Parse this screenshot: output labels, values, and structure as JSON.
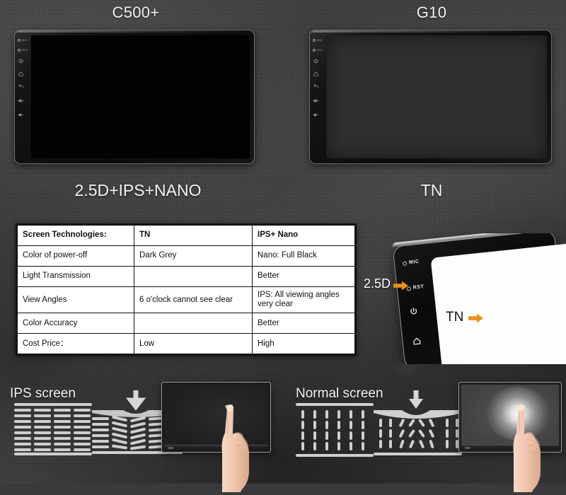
{
  "background": {
    "base_color": "#3a3a3c",
    "style": "dark concrete texture"
  },
  "top_section": {
    "left_device": {
      "title": "C500+",
      "subtitle": "2.5D+IPS+NANO",
      "panel_type": "nano-black",
      "side_buttons": [
        {
          "name": "mic-button",
          "label": "MIC",
          "icon": "mic-icon"
        },
        {
          "name": "reset-button",
          "label": "RST",
          "icon": "reset-icon"
        },
        {
          "name": "power-button",
          "label": "",
          "icon": "power-icon"
        },
        {
          "name": "home-button",
          "label": "",
          "icon": "home-icon"
        },
        {
          "name": "back-button",
          "label": "",
          "icon": "back-icon"
        },
        {
          "name": "volume-up-button",
          "label": "",
          "icon": "volume-up-icon"
        },
        {
          "name": "volume-down-button",
          "label": "",
          "icon": "volume-down-icon"
        }
      ]
    },
    "right_device": {
      "title": "G10",
      "subtitle": "TN",
      "panel_type": "tn-grey",
      "side_buttons": [
        {
          "name": "mic-button",
          "label": "MIC",
          "icon": "mic-icon"
        },
        {
          "name": "reset-button",
          "label": "RST",
          "icon": "reset-icon"
        },
        {
          "name": "power-button",
          "label": "",
          "icon": "power-icon"
        },
        {
          "name": "home-button",
          "label": "",
          "icon": "home-icon"
        },
        {
          "name": "back-button",
          "label": "",
          "icon": "back-icon"
        },
        {
          "name": "volume-up-button",
          "label": "",
          "icon": "volume-up-icon"
        },
        {
          "name": "volume-down-button",
          "label": "",
          "icon": "volume-down-icon"
        }
      ]
    }
  },
  "comparison_table": {
    "columns": [
      "Screen Technologies:",
      "TN",
      "IPS+ Nano"
    ],
    "rows": [
      {
        "feature": "Color of power-off",
        "tn": "Dark Grey",
        "ips_nano": "Nano: Full Black"
      },
      {
        "feature": "Light Transmission",
        "tn": "",
        "ips_nano": "Better"
      },
      {
        "feature": "View Angles",
        "tn": "6 o'clock cannot see clear",
        "ips_nano": "IPS: All viewing angles very clear"
      },
      {
        "feature": "Color Accuracy",
        "tn": "",
        "ips_nano": "Better"
      },
      {
        "feature": "Cost Price：",
        "tn": "Low",
        "ips_nano": "High"
      }
    ]
  },
  "glass_illustration": {
    "front_label": "2.5D",
    "back_label": "TN",
    "arrow_color": "#E8901A",
    "front_buttons": [
      {
        "label": "MIC",
        "icon": "mic-icon"
      },
      {
        "label": "RST",
        "icon": "reset-icon"
      },
      {
        "label": "",
        "icon": "power-icon"
      },
      {
        "label": "",
        "icon": "home-icon"
      }
    ],
    "back_buttons": [
      {
        "label": "MIC",
        "icon": "mic-icon"
      },
      {
        "label": "RST",
        "icon": "reset-icon"
      }
    ]
  },
  "bottom_section": {
    "left": {
      "label": "IPS screen",
      "crystal_orientation": "horizontal",
      "pressure_arrow": "down-arrow-icon",
      "monitor_state": "no-light-leak",
      "screen_color": "#232325"
    },
    "right": {
      "label": "Normal screen",
      "crystal_orientation": "vertical",
      "pressure_arrow": "down-arrow-icon",
      "monitor_state": "light-leak-glow",
      "screen_color": "#4a4a4c"
    }
  }
}
